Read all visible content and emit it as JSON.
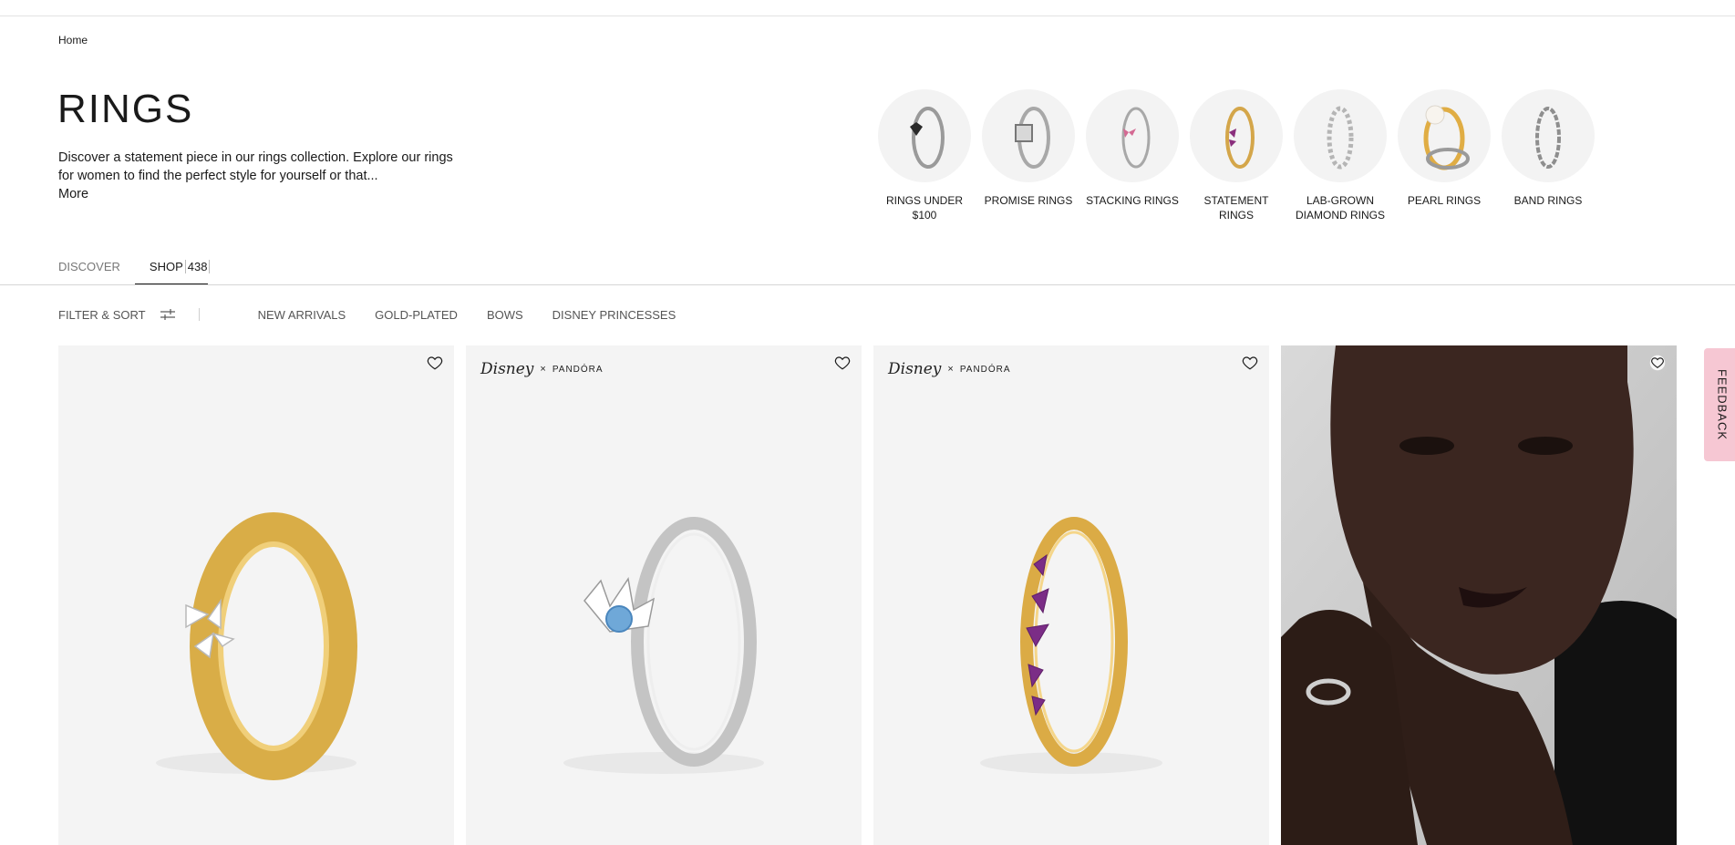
{
  "breadcrumb": {
    "home": "Home"
  },
  "header": {
    "title": "RINGS",
    "description": "Discover a statement piece in our rings collection. Explore our rings for women to find the perfect style for yourself or that...",
    "more": "More"
  },
  "categories": [
    {
      "label": "RINGS UNDER $100",
      "icon": "silver-heart-ring-icon"
    },
    {
      "label": "PROMISE RINGS",
      "icon": "square-halo-ring-icon"
    },
    {
      "label": "STACKING RINGS",
      "icon": "pink-butterfly-ring-icon"
    },
    {
      "label": "STATEMENT RINGS",
      "icon": "gold-purple-ring-icon"
    },
    {
      "label": "LAB-GROWN DIAMOND RINGS",
      "icon": "eternity-band-icon"
    },
    {
      "label": "PEARL RINGS",
      "icon": "pearl-ring-icon"
    },
    {
      "label": "BAND RINGS",
      "icon": "wavy-band-icon"
    }
  ],
  "tabs": {
    "discover": "DISCOVER",
    "shop": "SHOP",
    "shop_count": "438"
  },
  "filters": {
    "filter_sort": "FILTER & SORT",
    "chips": [
      "NEW ARRIVALS",
      "GOLD-PLATED",
      "BOWS",
      "DISNEY PRINCESSES"
    ]
  },
  "products": [
    {
      "brand": null
    },
    {
      "brand": {
        "disney": "Disney",
        "x": "×",
        "pandora": "PANDÓRA"
      }
    },
    {
      "brand": {
        "disney": "Disney",
        "x": "×",
        "pandora": "PANDÓRA"
      }
    },
    {
      "brand": null
    }
  ],
  "feedback": "FEEDBACK",
  "colors": {
    "feedback_bg": "#f6c7d3",
    "card_bg": "#f4f4f4",
    "text": "#1a1a1a"
  }
}
